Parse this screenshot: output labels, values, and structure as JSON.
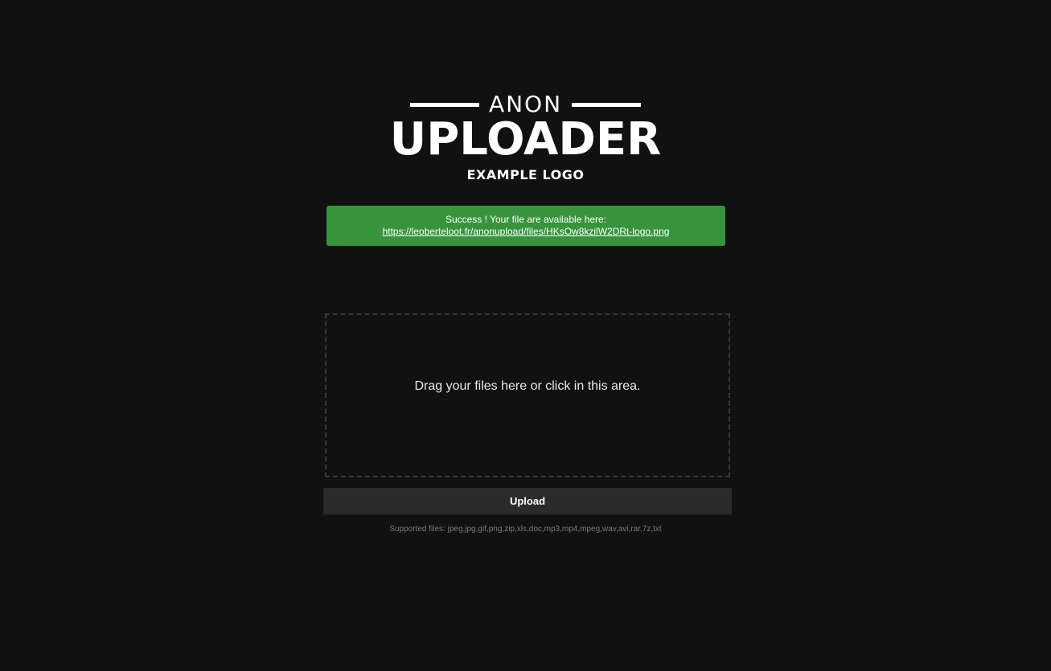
{
  "logo": {
    "top_text": "ANON",
    "main_text": "UPLOADER",
    "sub_text": "EXAMPLE LOGO"
  },
  "alert": {
    "message": "Success ! Your file are available here:",
    "link_text": "https://leoberteloot.fr/anonupload/files/HKsOw8kzilW2DRt-logo.png",
    "color": "#37943d"
  },
  "dropzone": {
    "text": "Drag your files here or click in this area."
  },
  "upload": {
    "label": "Upload"
  },
  "supported": {
    "text": "Supported files: jpeg,jpg,gif,png,zip,xls,doc,mp3,mp4,mpeg,wav,avi,rar,7z,txt"
  }
}
